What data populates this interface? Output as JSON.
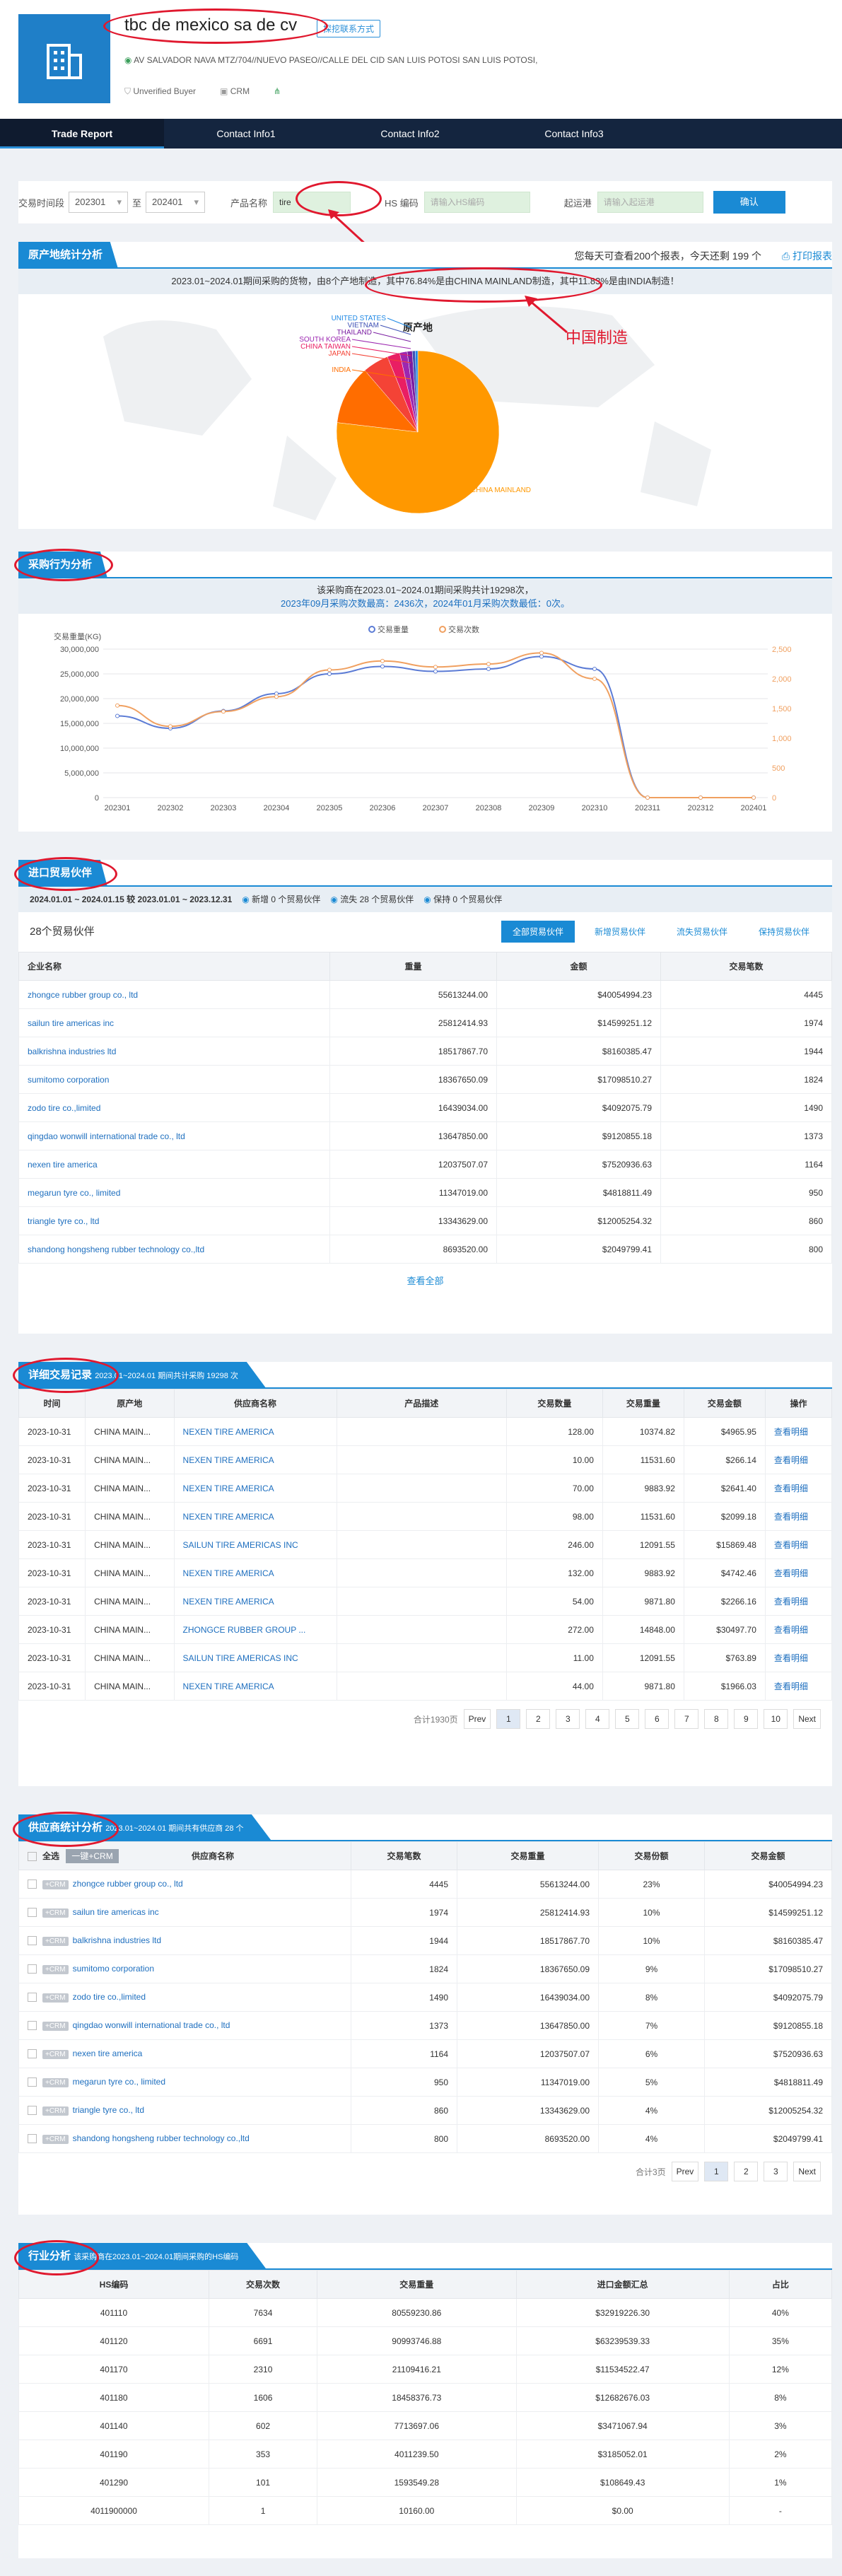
{
  "company": {
    "name": "tbc de mexico sa de cv",
    "tag": "探挖联系方式",
    "address": "AV SALVADOR NAVA MTZ/704//NUEVO PASEO//CALLE DEL CID SAN LUIS POTOSI SAN LUIS POTOSI,",
    "buyer": "Unverified Buyer",
    "crm": "CRM"
  },
  "nav": [
    "Trade Report",
    "Contact Info1",
    "Contact Info2",
    "Contact Info3"
  ],
  "filter": {
    "period_label": "交易时间段",
    "from": "202301",
    "to_label": "至",
    "to": "202401",
    "product_label": "产品名称",
    "product": "tire",
    "hs_label": "HS 编码",
    "hs_ph": "请输入HS编码",
    "port_label": "起运港",
    "port_ph": "请输入起运港",
    "ok": "确认"
  },
  "origin": {
    "title": "原产地统计分析",
    "quota": "您每天可查看200个报表，今天还剩 199 个",
    "print": "打印报表",
    "summary": "2023.01~2024.01期间采购的货物，由8个产地制造，其中76.84%是由CHINA MAINLAND制造，其中11.83%是由INDIA制造！",
    "annotation": "中国制造",
    "chart_title": "原产地",
    "chart_data": {
      "type": "pie",
      "slices": [
        {
          "label": "CHINA MAINLAND",
          "value": 76.84
        },
        {
          "label": "INDIA",
          "value": 11.83
        },
        {
          "label": "JAPAN",
          "value": 5.2
        },
        {
          "label": "CHINA TAIWAN",
          "value": 2.5
        },
        {
          "label": "SOUTH KOREA",
          "value": 1.5
        },
        {
          "label": "THAILAND",
          "value": 1.0
        },
        {
          "label": "VIETNAM",
          "value": 0.6
        },
        {
          "label": "UNITED STATES",
          "value": 0.5
        }
      ],
      "colors": [
        "#ff9800",
        "#ff6d00",
        "#f44336",
        "#e91e63",
        "#9c27b0",
        "#7b1fa2",
        "#3f51b5",
        "#1e88e5"
      ]
    }
  },
  "purchase": {
    "title": "采购行为分析",
    "line1": "该采购商在2023.01~2024.01期间采购共计19298次，",
    "line2": "2023年09月采购次数最高：2436次，2024年01月采购次数最低：0次。",
    "ylabel": "交易重量(KG)",
    "legend": [
      "交易重量",
      "交易次数"
    ],
    "chart_data": {
      "type": "line",
      "x": [
        "202301",
        "202302",
        "202303",
        "202304",
        "202305",
        "202306",
        "202307",
        "202308",
        "202309",
        "202310",
        "202311",
        "202312",
        "202401"
      ],
      "series": [
        {
          "name": "交易重量",
          "values": [
            16500000,
            14000000,
            17500000,
            21000000,
            25000000,
            26500000,
            25500000,
            26000000,
            28500000,
            26000000,
            0,
            0,
            0
          ],
          "color": "#5b7bd5"
        },
        {
          "name": "交易次数",
          "values": [
            1550,
            1200,
            1450,
            1700,
            2150,
            2300,
            2200,
            2250,
            2436,
            2000,
            0,
            0,
            0
          ],
          "color": "#f0a060"
        }
      ],
      "ylim": [
        0,
        30000000
      ],
      "y2lim": [
        0,
        2500
      ],
      "yticks": [
        "30,000,000",
        "25,000,000",
        "20,000,000",
        "15,000,000",
        "10,000,000",
        "5,000,000",
        "0"
      ],
      "y2ticks": [
        "2,500",
        "2,000",
        "1,500",
        "1,000",
        "500",
        "0"
      ]
    }
  },
  "partners": {
    "title": "进口贸易伙伴",
    "range": "2024.01.01 ~ 2024.01.15 较 2023.01.01 ~ 2023.12.31",
    "new": "新增 0 个贸易伙伴",
    "lost": "流失 28 个贸易伙伴",
    "keep": "保持 0 个贸易伙伴",
    "count": "28个贸易伙伴",
    "tabs": [
      "全部贸易伙伴",
      "新增贸易伙伴",
      "流失贸易伙伴",
      "保持贸易伙伴"
    ],
    "cols": [
      "企业名称",
      "重量",
      "金额",
      "交易笔数"
    ],
    "rows": [
      [
        "zhongce rubber group co., ltd",
        "55613244.00",
        "$40054994.23",
        "4445"
      ],
      [
        "sailun tire americas inc",
        "25812414.93",
        "$14599251.12",
        "1974"
      ],
      [
        "balkrishna industries ltd",
        "18517867.70",
        "$8160385.47",
        "1944"
      ],
      [
        "sumitomo corporation",
        "18367650.09",
        "$17098510.27",
        "1824"
      ],
      [
        "zodo tire co.,limited",
        "16439034.00",
        "$4092075.79",
        "1490"
      ],
      [
        "qingdao wonwill international trade co., ltd",
        "13647850.00",
        "$9120855.18",
        "1373"
      ],
      [
        "nexen tire america",
        "12037507.07",
        "$7520936.63",
        "1164"
      ],
      [
        "megarun tyre co., limited",
        "11347019.00",
        "$4818811.49",
        "950"
      ],
      [
        "triangle tyre co., ltd",
        "13343629.00",
        "$12005254.32",
        "860"
      ],
      [
        "shandong hongsheng rubber technology co.,ltd",
        "8693520.00",
        "$2049799.41",
        "800"
      ]
    ],
    "more": "查看全部"
  },
  "records": {
    "title": "详细交易记录",
    "sub": "2023.01~2024.01 期间共计采购 19298 次",
    "cols": [
      "时间",
      "原产地",
      "供应商名称",
      "产品描述",
      "交易数量",
      "交易重量",
      "交易金额",
      "操作"
    ],
    "rows": [
      [
        "2023-10-31",
        "CHINA MAIN...",
        "NEXEN TIRE AMERICA",
        "",
        "128.00",
        "10374.82",
        "$4965.95",
        "查看明细"
      ],
      [
        "2023-10-31",
        "CHINA MAIN...",
        "NEXEN TIRE AMERICA",
        "",
        "10.00",
        "11531.60",
        "$266.14",
        "查看明细"
      ],
      [
        "2023-10-31",
        "CHINA MAIN...",
        "NEXEN TIRE AMERICA",
        "",
        "70.00",
        "9883.92",
        "$2641.40",
        "查看明细"
      ],
      [
        "2023-10-31",
        "CHINA MAIN...",
        "NEXEN TIRE AMERICA",
        "",
        "98.00",
        "11531.60",
        "$2099.18",
        "查看明细"
      ],
      [
        "2023-10-31",
        "CHINA MAIN...",
        "SAILUN TIRE AMERICAS INC",
        "",
        "246.00",
        "12091.55",
        "$15869.48",
        "查看明细"
      ],
      [
        "2023-10-31",
        "CHINA MAIN...",
        "NEXEN TIRE AMERICA",
        "",
        "132.00",
        "9883.92",
        "$4742.46",
        "查看明细"
      ],
      [
        "2023-10-31",
        "CHINA MAIN...",
        "NEXEN TIRE AMERICA",
        "",
        "54.00",
        "9871.80",
        "$2266.16",
        "查看明细"
      ],
      [
        "2023-10-31",
        "CHINA MAIN...",
        "ZHONGCE RUBBER GROUP ...",
        "",
        "272.00",
        "14848.00",
        "$30497.70",
        "查看明细"
      ],
      [
        "2023-10-31",
        "CHINA MAIN...",
        "SAILUN TIRE AMERICAS INC",
        "",
        "11.00",
        "12091.55",
        "$763.89",
        "查看明细"
      ],
      [
        "2023-10-31",
        "CHINA MAIN...",
        "NEXEN TIRE AMERICA",
        "",
        "44.00",
        "9871.80",
        "$1966.03",
        "查看明细"
      ]
    ],
    "total": "合计1930页",
    "pages": [
      "Prev",
      "1",
      "2",
      "3",
      "4",
      "5",
      "6",
      "7",
      "8",
      "9",
      "10",
      "Next"
    ]
  },
  "suppliers": {
    "title": "供应商统计分析",
    "sub": "2023.01~2024.01 期间共有供应商 28 个",
    "selectall": "全选",
    "addcrm": "一键+CRM",
    "cols": [
      "供应商名称",
      "交易笔数",
      "交易重量",
      "交易份额",
      "交易金额"
    ],
    "crmtag": "+CRM",
    "rows": [
      [
        "zhongce rubber group co., ltd",
        "4445",
        "55613244.00",
        "23%",
        "$40054994.23"
      ],
      [
        "sailun tire americas inc",
        "1974",
        "25812414.93",
        "10%",
        "$14599251.12"
      ],
      [
        "balkrishna industries ltd",
        "1944",
        "18517867.70",
        "10%",
        "$8160385.47"
      ],
      [
        "sumitomo corporation",
        "1824",
        "18367650.09",
        "9%",
        "$17098510.27"
      ],
      [
        "zodo tire co.,limited",
        "1490",
        "16439034.00",
        "8%",
        "$4092075.79"
      ],
      [
        "qingdao wonwill international trade co., ltd",
        "1373",
        "13647850.00",
        "7%",
        "$9120855.18"
      ],
      [
        "nexen tire america",
        "1164",
        "12037507.07",
        "6%",
        "$7520936.63"
      ],
      [
        "megarun tyre co., limited",
        "950",
        "11347019.00",
        "5%",
        "$4818811.49"
      ],
      [
        "triangle tyre co., ltd",
        "860",
        "13343629.00",
        "4%",
        "$12005254.32"
      ],
      [
        "shandong hongsheng rubber technology co.,ltd",
        "800",
        "8693520.00",
        "4%",
        "$2049799.41"
      ]
    ],
    "total": "合计3页",
    "pages": [
      "Prev",
      "1",
      "2",
      "3",
      "Next"
    ]
  },
  "industry": {
    "title": "行业分析",
    "sub": "该采购商在2023.01~2024.01期间采购的HS编码",
    "cols": [
      "HS编码",
      "交易次数",
      "交易重量",
      "进口金额汇总",
      "占比"
    ],
    "rows": [
      [
        "401110",
        "7634",
        "80559230.86",
        "$32919226.30",
        "40%"
      ],
      [
        "401120",
        "6691",
        "90993746.88",
        "$63239539.33",
        "35%"
      ],
      [
        "401170",
        "2310",
        "21109416.21",
        "$11534522.47",
        "12%"
      ],
      [
        "401180",
        "1606",
        "18458376.73",
        "$12682676.03",
        "8%"
      ],
      [
        "401140",
        "602",
        "7713697.06",
        "$3471067.94",
        "3%"
      ],
      [
        "401190",
        "353",
        "4011239.50",
        "$3185052.01",
        "2%"
      ],
      [
        "401290",
        "101",
        "1593549.28",
        "$108649.43",
        "1%"
      ],
      [
        "4011900000",
        "1",
        "10160.00",
        "$0.00",
        "-"
      ]
    ]
  }
}
